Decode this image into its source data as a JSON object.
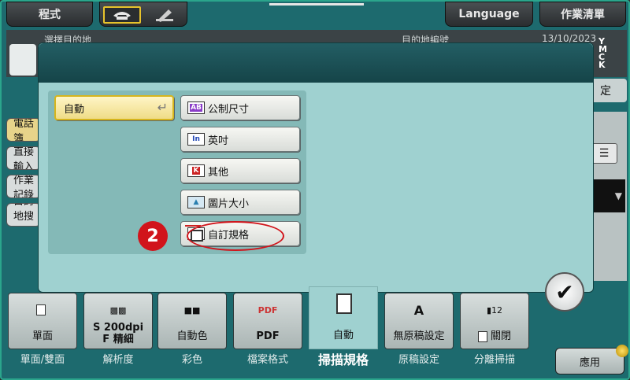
{
  "topbar": {
    "program_label": "程式",
    "language_label": "Language",
    "joblist_label": "作業清單"
  },
  "background": {
    "destination_label": "選擇目的地",
    "destination_number_label": "目的地編號",
    "date": "13/10/2023",
    "toner": [
      "Y",
      "M",
      "C",
      "K"
    ],
    "set_label": "定",
    "left_tabs": [
      "電話簿",
      "直接輸入",
      "作業記錄",
      "目的地搜尋"
    ]
  },
  "dialog": {
    "auto_label": "自動",
    "size_options": [
      {
        "icon": "AB",
        "label": "公制尺寸"
      },
      {
        "icon": "In",
        "label": "英吋"
      },
      {
        "icon": "K",
        "label": "其他"
      },
      {
        "icon": "picture",
        "label": "圖片大小"
      },
      {
        "icon": "custom",
        "label": "自訂規格"
      }
    ],
    "step_number": "2",
    "ok_symbol": "✔"
  },
  "functions": [
    {
      "value": "單面",
      "caption": "單面/雙面"
    },
    {
      "value": "S 200dpi\nF 精細",
      "caption": "解析度"
    },
    {
      "value": "自動色",
      "caption": "彩色"
    },
    {
      "value": "PDF",
      "caption": "檔案格式"
    },
    {
      "value": "自動",
      "caption": "掃描規格"
    },
    {
      "value": "無原稿設定",
      "caption": "原稿設定"
    },
    {
      "value": "關閉",
      "caption": "分離掃描"
    }
  ],
  "apply_label": "應用",
  "colors": {
    "accent_yellow": "#e7c32b",
    "dialog_bg": "#9fd1d0",
    "highlight_red": "#d1141b"
  }
}
